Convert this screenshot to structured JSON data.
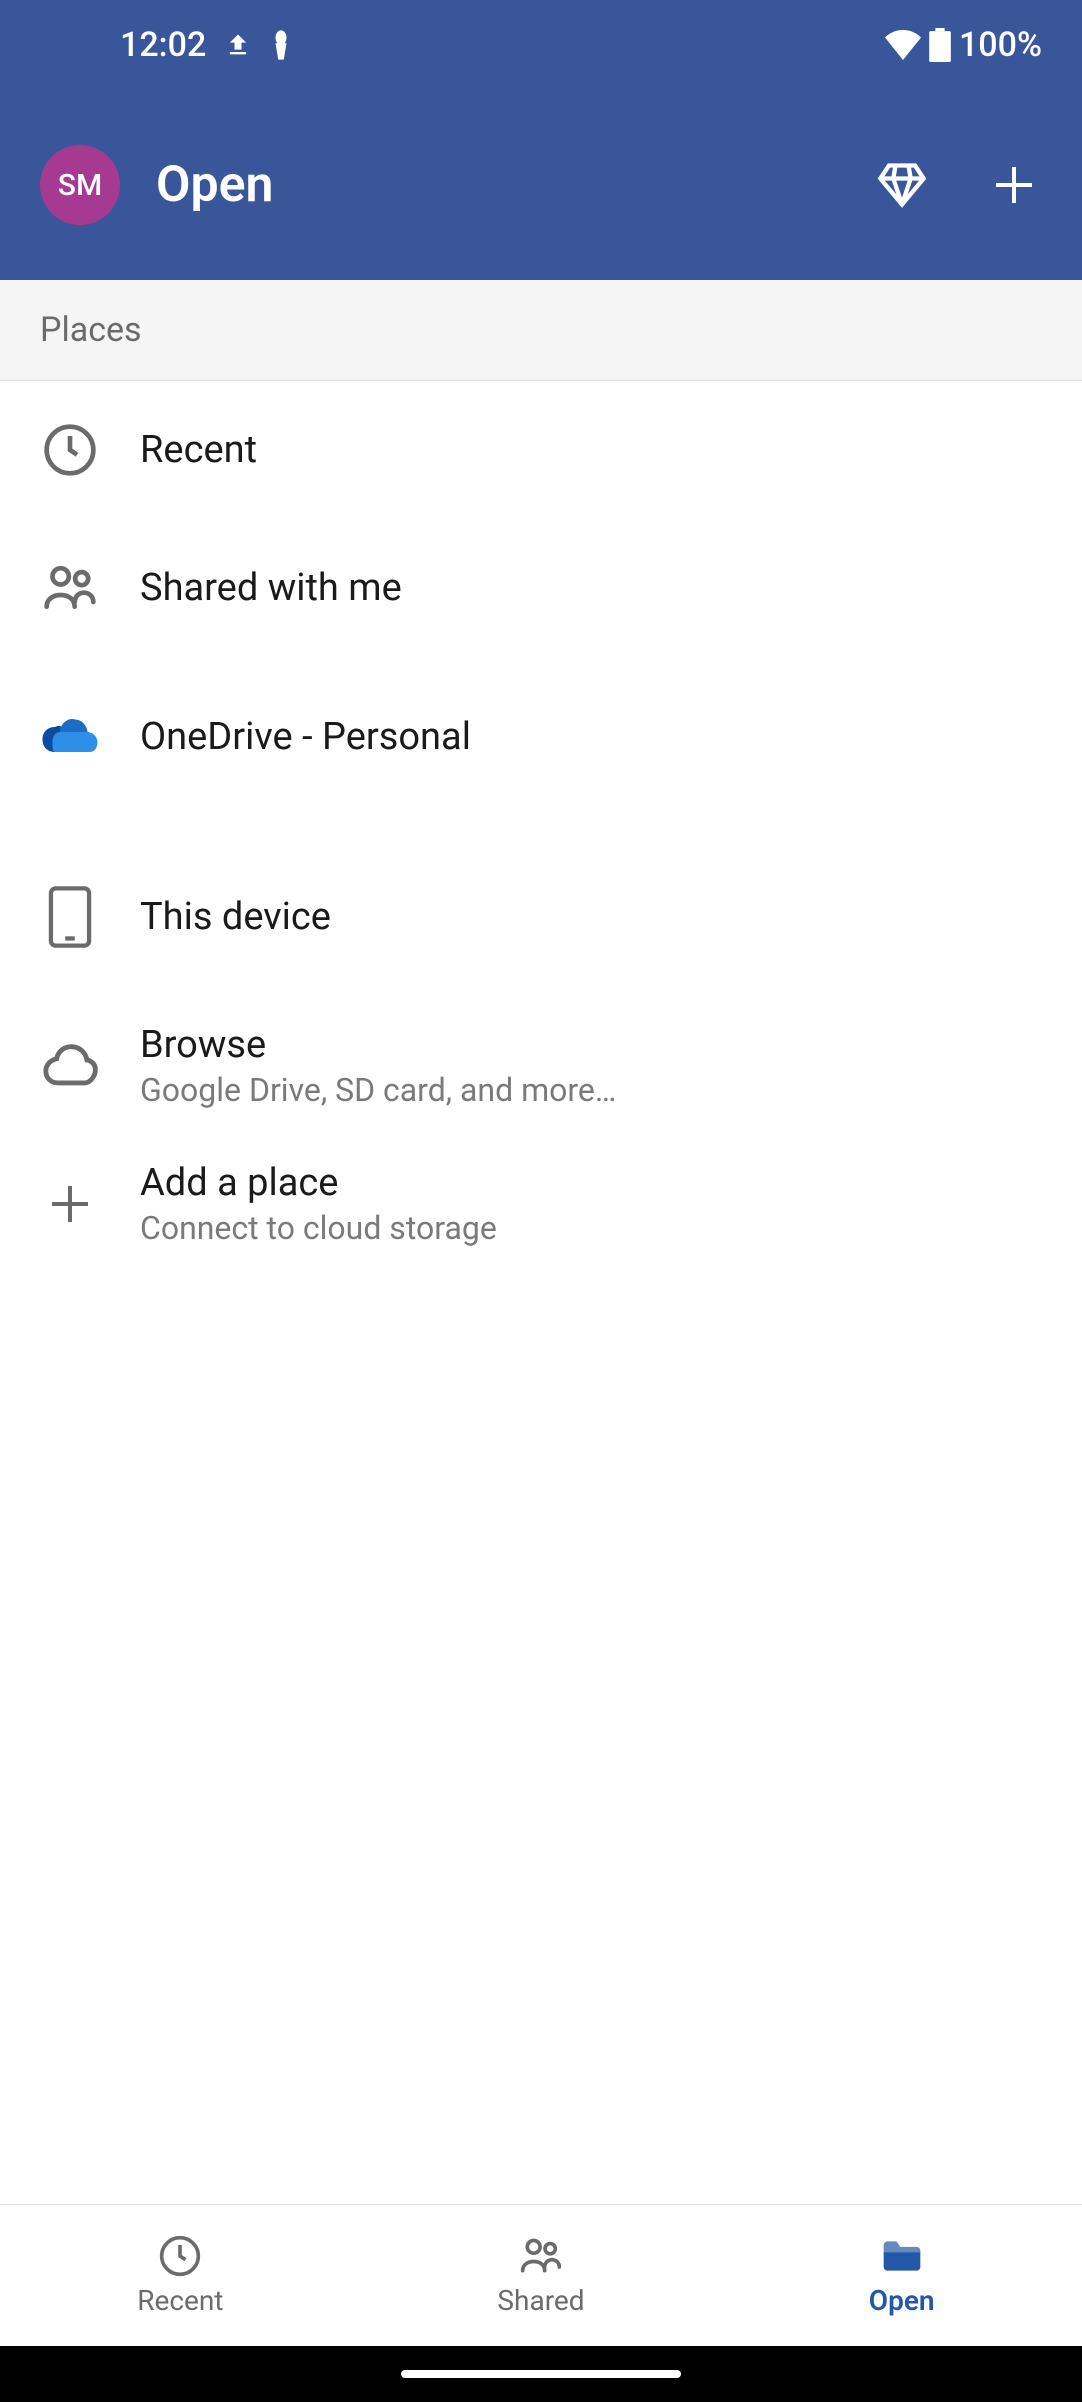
{
  "status_bar": {
    "time": "12:02",
    "battery": "100%"
  },
  "app_bar": {
    "avatar_initials": "SM",
    "title": "Open"
  },
  "section": {
    "header": "Places"
  },
  "places": {
    "recent": {
      "label": "Recent"
    },
    "shared": {
      "label": "Shared with me"
    },
    "onedrive": {
      "label": "OneDrive - Personal"
    },
    "device": {
      "label": "This device"
    },
    "browse": {
      "label": "Browse",
      "sublabel": "Google Drive, SD card, and more…"
    },
    "add": {
      "label": "Add a place",
      "sublabel": "Connect to cloud storage"
    }
  },
  "bottom_nav": {
    "recent": "Recent",
    "shared": "Shared",
    "open": "Open"
  }
}
